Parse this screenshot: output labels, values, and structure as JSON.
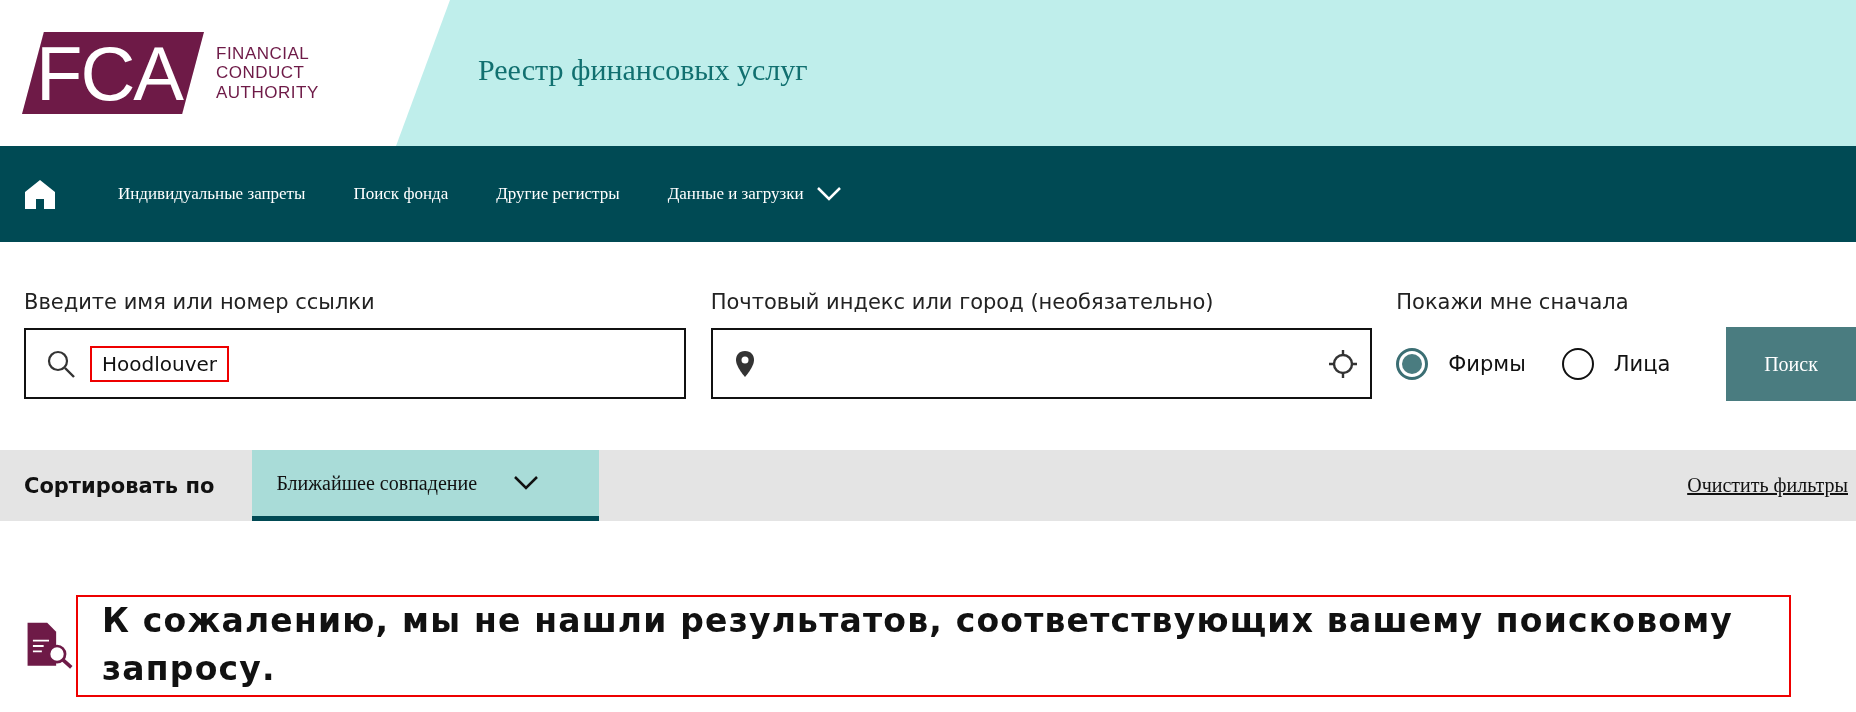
{
  "logo": {
    "mark": "FCA",
    "lines": [
      "FINANCIAL",
      "CONDUCT",
      "AUTHORITY"
    ]
  },
  "header": {
    "title": "Реестр финансовых услуг"
  },
  "nav": {
    "items": [
      {
        "label": "Индивидуальные запреты",
        "has_menu": false
      },
      {
        "label": "Поиск фонда",
        "has_menu": false
      },
      {
        "label": "Другие регистры",
        "has_menu": false
      },
      {
        "label": "Данные и загрузки",
        "has_menu": true
      }
    ]
  },
  "search": {
    "name_label": "Введите имя или номер ссылки",
    "name_value": "Hoodlouver",
    "name_highlighted": true,
    "location_label": "Почтовый индекс или город (необязательно)",
    "show_first_label": "Покажи мне сначала",
    "options": [
      {
        "label": "Фирмы",
        "selected": true
      },
      {
        "label": "Лица",
        "selected": false
      }
    ],
    "button": "Поиск"
  },
  "sort": {
    "label": "Сортировать по",
    "value": "Ближайшее совпадение",
    "clear": "Очистить фильтры"
  },
  "message": {
    "text": "К сожалению, мы не нашли результатов, соответствующих вашему поисковому запросу.",
    "highlighted": true
  }
}
